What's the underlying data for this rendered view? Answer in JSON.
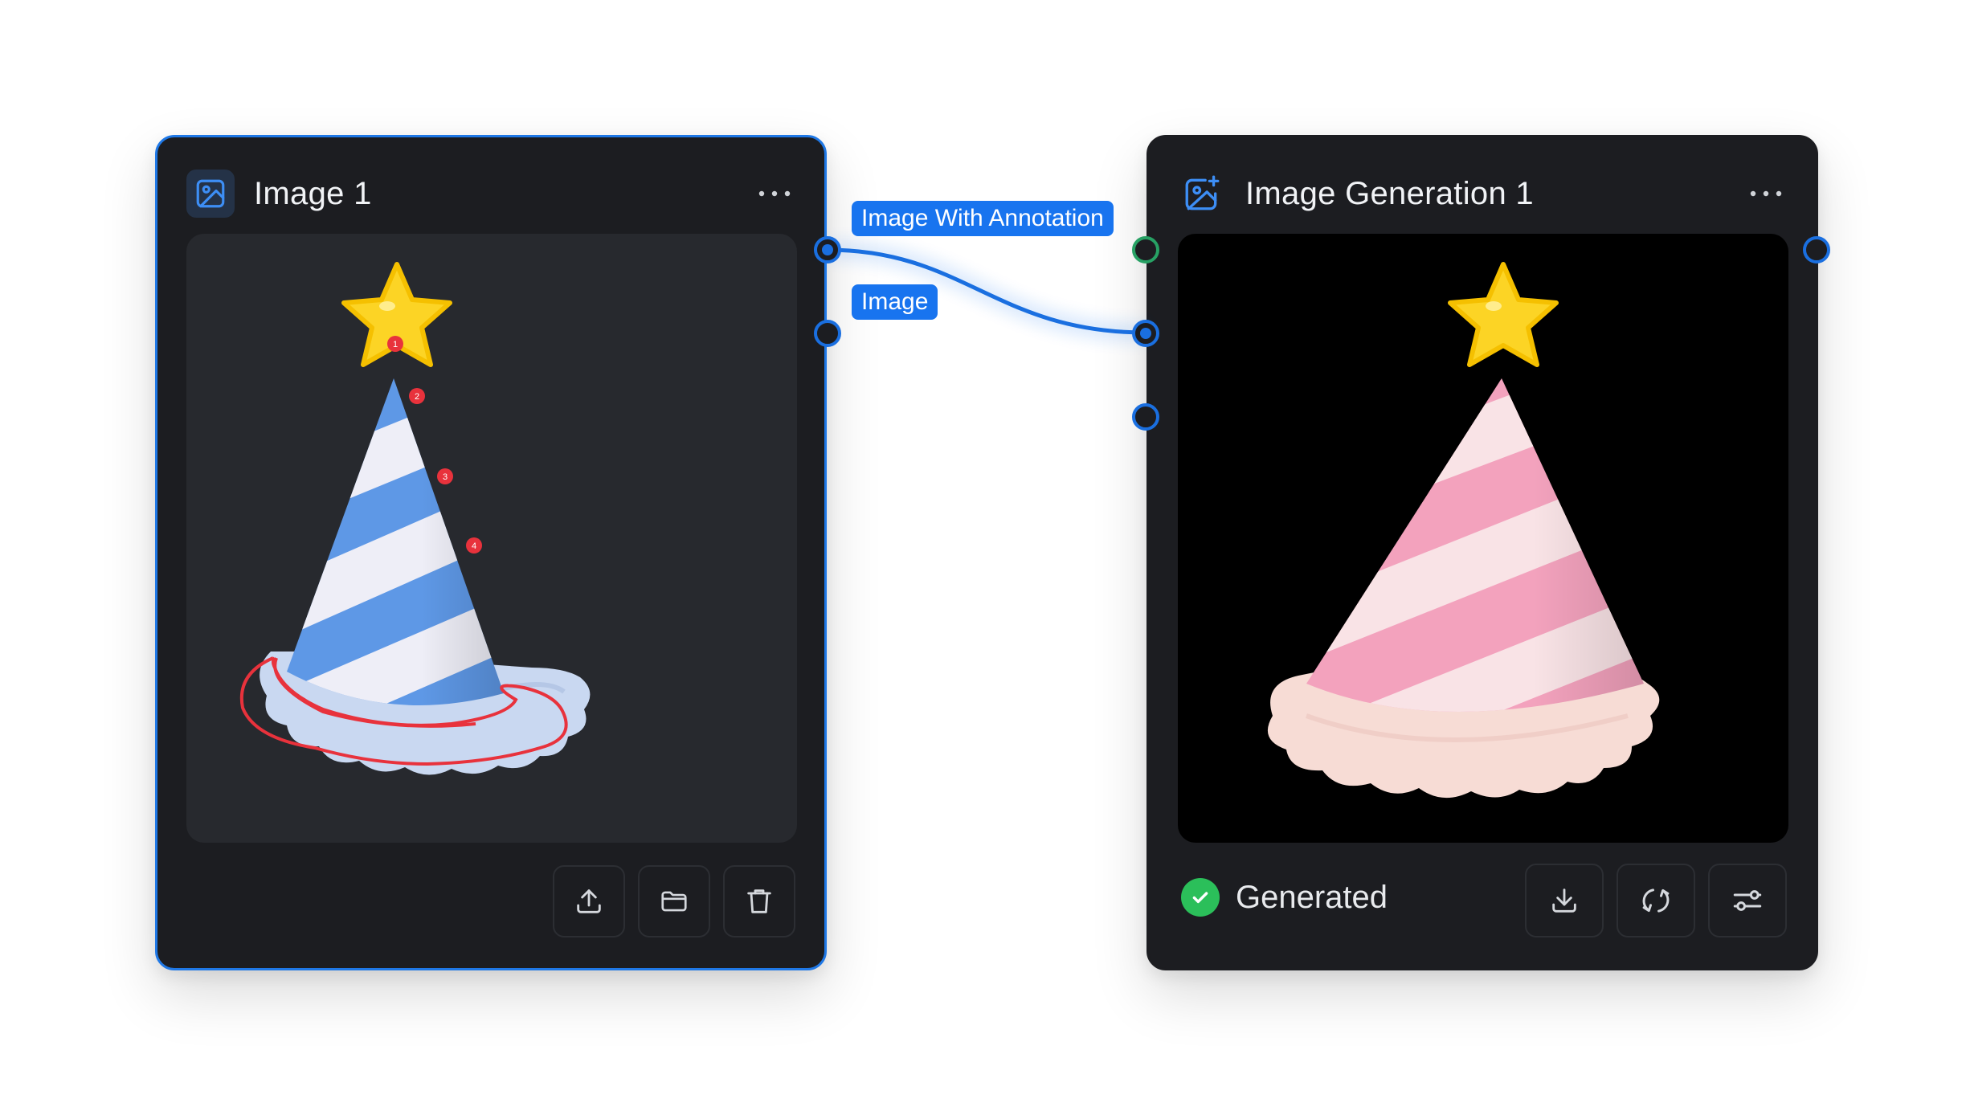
{
  "nodes": {
    "image": {
      "title": "Image 1",
      "icon": "image-icon",
      "menu_icon": "more-horizontal-icon",
      "annotation_markers": [
        "1",
        "2",
        "3",
        "4"
      ],
      "buttons": [
        {
          "name": "upload-button",
          "icon": "upload-icon"
        },
        {
          "name": "open-folder-button",
          "icon": "folder-icon"
        },
        {
          "name": "delete-button",
          "icon": "trash-icon"
        }
      ]
    },
    "generation": {
      "title": "Image Generation 1",
      "icon": "image-sparkle-icon",
      "menu_icon": "more-horizontal-icon",
      "status": "Generated",
      "buttons": [
        {
          "name": "download-button",
          "icon": "download-icon"
        },
        {
          "name": "regenerate-button",
          "icon": "refresh-icon"
        },
        {
          "name": "settings-button",
          "icon": "sliders-icon"
        }
      ]
    }
  },
  "connections": {
    "labels": {
      "annotation": "Image With Annotation",
      "image": "Image"
    }
  },
  "colors": {
    "accent": "#1874ef",
    "node_background": "#1c1d21",
    "success": "#2bbf5a",
    "annotation": "#e8323c"
  }
}
